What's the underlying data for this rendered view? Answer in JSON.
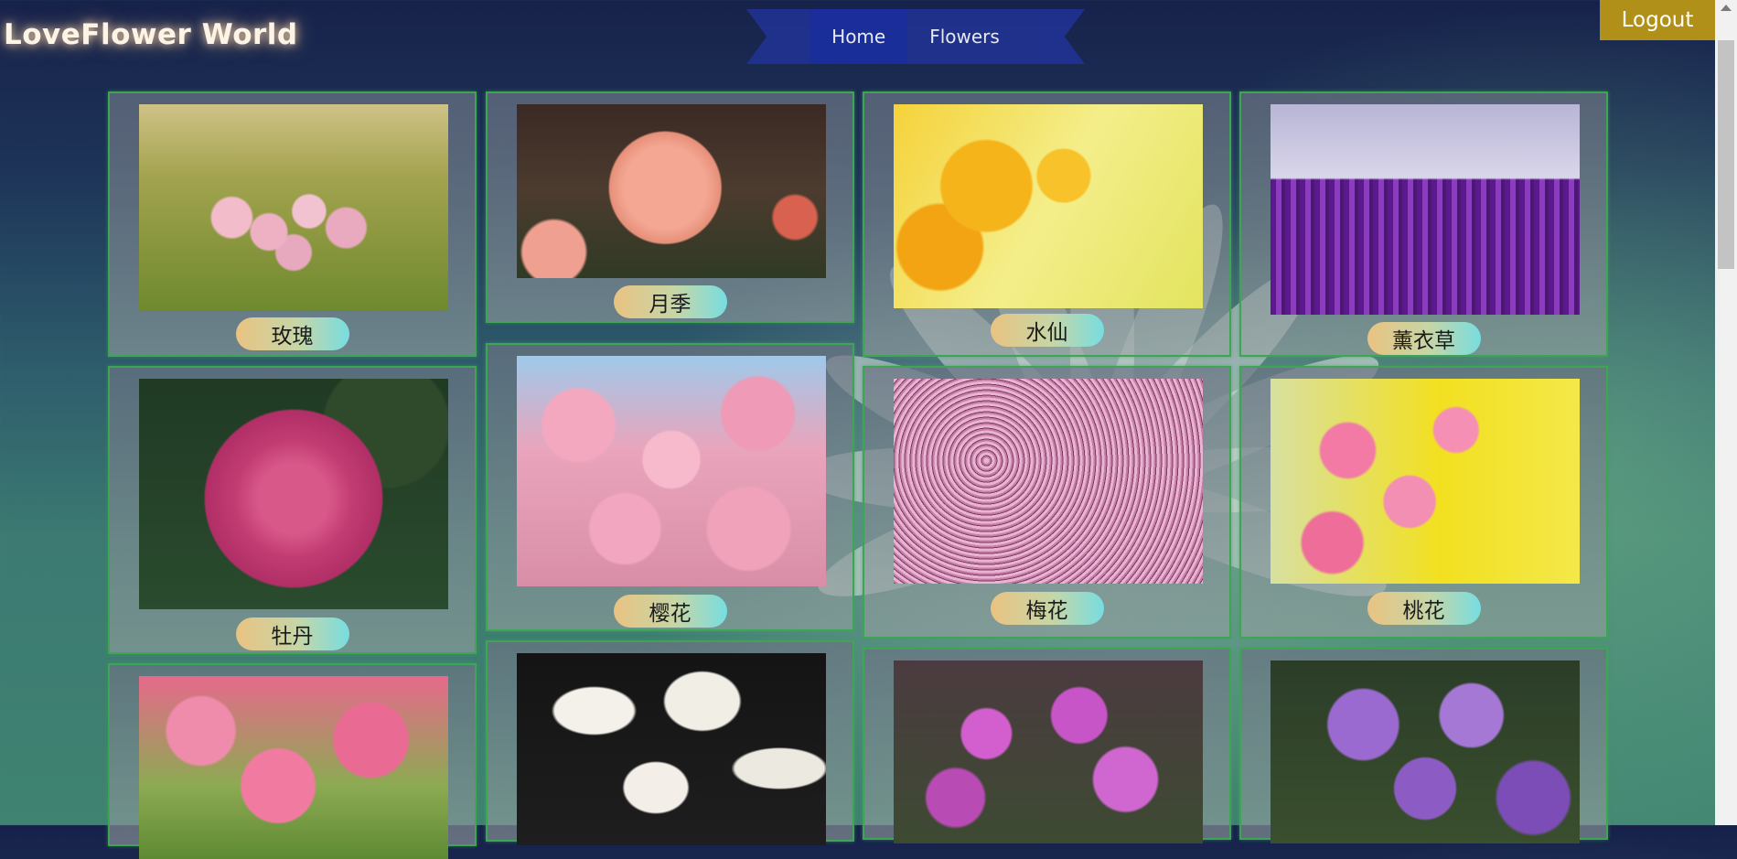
{
  "header": {
    "logo": "LoveFlower World",
    "nav": [
      {
        "label": "Home"
      },
      {
        "label": "Flowers"
      }
    ],
    "logout_label": "Logout"
  },
  "flowers": [
    {
      "name": "玫瑰"
    },
    {
      "name": "月季"
    },
    {
      "name": "水仙"
    },
    {
      "name": "薰衣草"
    },
    {
      "name": "牡丹"
    },
    {
      "name": "樱花"
    },
    {
      "name": "梅花"
    },
    {
      "name": "桃花"
    },
    {
      "name": ""
    },
    {
      "name": ""
    },
    {
      "name": ""
    },
    {
      "name": ""
    }
  ],
  "colors": {
    "card_border": "#3fa455",
    "logout_bg": "#b1901a",
    "nav_bg": "#20328f"
  }
}
